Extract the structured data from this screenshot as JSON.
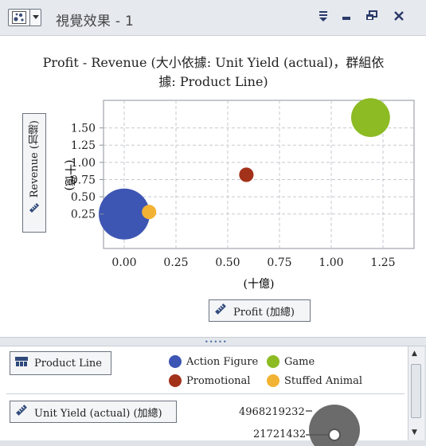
{
  "window": {
    "title": "視覺效果 - 1",
    "controls": {
      "filter": "⩸",
      "minimize": "▁",
      "restore": "⧉",
      "close": "✕"
    }
  },
  "chart_data": {
    "type": "scatter",
    "title": "Profit - Revenue (大小依據: Unit Yield (actual)，群組依據: Product Line)",
    "title_line1": "Profit - Revenue (大小依據: Unit Yield (actual)，群組依",
    "title_line2": "據: Product Line)",
    "xlabel": "Profit (加總)",
    "xunit": "(十億)",
    "ylabel": "Revenue (加總)",
    "yunit": "(十億)",
    "xlim": [
      -0.1,
      1.4
    ],
    "ylim": [
      -0.25,
      1.9
    ],
    "xticks": [
      "0.00",
      "0.25",
      "0.50",
      "0.75",
      "1.00",
      "1.25"
    ],
    "yticks": [
      "0.25",
      "0.50",
      "0.75",
      "1.00",
      "1.25",
      "1.50"
    ],
    "grid": true,
    "series": [
      {
        "name": "Action Figure",
        "color": "#3d55b3",
        "x": 0.0,
        "y": 0.25,
        "size": 4968219232
      },
      {
        "name": "Stuffed Animal",
        "color": "#f2b233",
        "x": 0.12,
        "y": 0.28,
        "size": 21721432
      },
      {
        "name": "Promotional",
        "color": "#a3321a",
        "x": 0.59,
        "y": 0.82,
        "size": 400000000
      },
      {
        "name": "Game",
        "color": "#8cbb24",
        "x": 1.19,
        "y": 1.65,
        "size": 2900000000
      }
    ]
  },
  "legend": {
    "group_button": "Product Line",
    "size_button": "Unit Yield (actual) (加總)",
    "size_max": "4968219232",
    "size_min": "21721432"
  }
}
